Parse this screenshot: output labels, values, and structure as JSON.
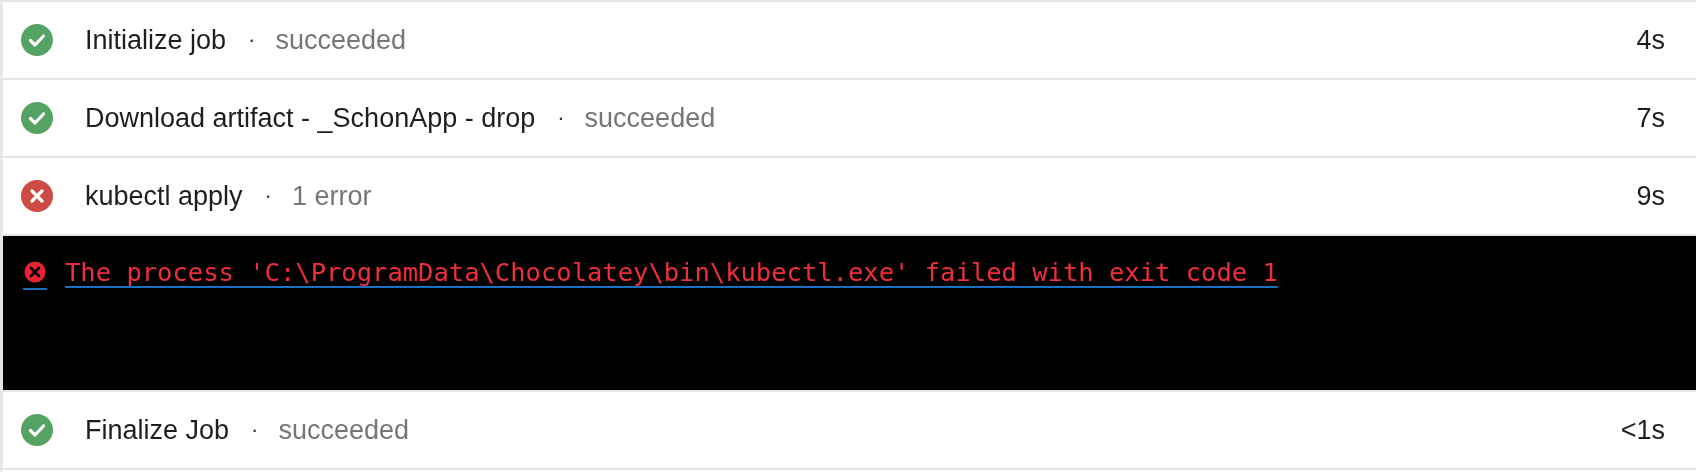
{
  "steps": [
    {
      "kind": "succeeded",
      "name": "Initialize job",
      "separator": "·",
      "detail": "succeeded",
      "duration": "4s"
    },
    {
      "kind": "succeeded",
      "name": "Download artifact - _SchonApp - drop",
      "separator": "·",
      "detail": "succeeded",
      "duration": "7s"
    },
    {
      "kind": "failed",
      "name": "kubectl apply",
      "separator": "·",
      "detail": "1 error",
      "duration": "9s",
      "log": [
        {
          "kind": "error",
          "text": "The process 'C:\\ProgramData\\Chocolatey\\bin\\kubectl.exe' failed with exit code 1"
        }
      ]
    },
    {
      "kind": "succeeded",
      "name": "Finalize Job",
      "separator": "·",
      "detail": "succeeded",
      "duration": "<1s"
    }
  ]
}
